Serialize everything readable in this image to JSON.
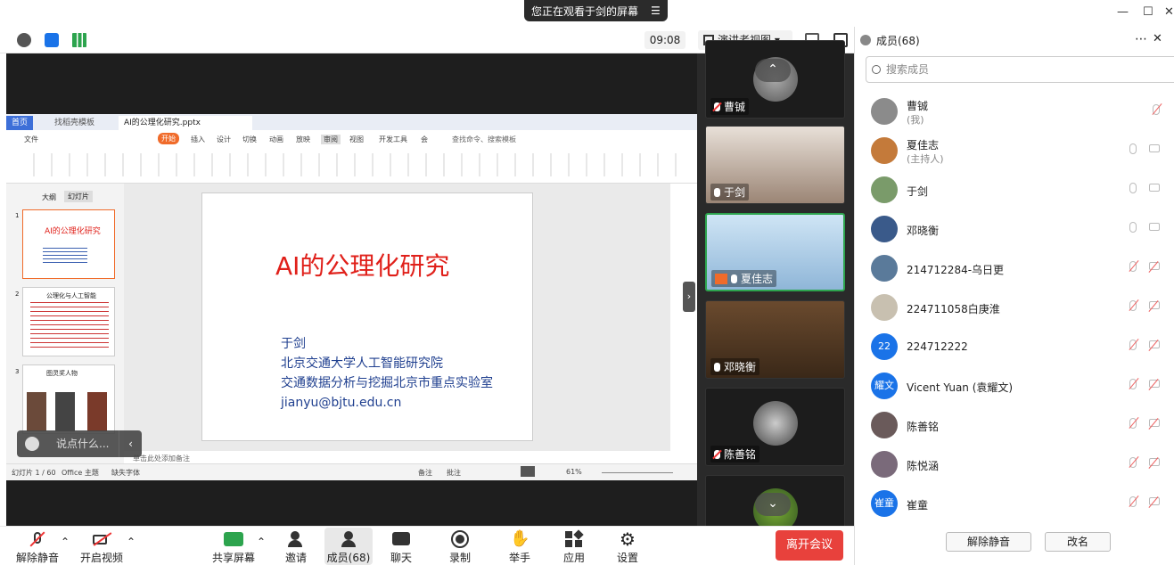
{
  "banner": {
    "text": "您正在观看于剑的屏幕"
  },
  "time": "09:08",
  "view_mode": "演讲者视图",
  "panel": {
    "title": "成员(68)",
    "search_placeholder": "搜索成员",
    "unmute_btn": "解除静音",
    "rename_btn": "改名"
  },
  "members": [
    {
      "name": "曹铖",
      "sub": "(我)",
      "mic_off": true,
      "cam_off": true
    },
    {
      "name": "夏佳志",
      "sub": "(主持人)",
      "mic_off": false,
      "cam_off": false
    },
    {
      "name": "于剑",
      "sub": "",
      "mic_off": false,
      "cam_off": false
    },
    {
      "name": "邓晓衡",
      "sub": "",
      "mic_off": false,
      "cam_off": false
    },
    {
      "name": "214712284-乌日更",
      "sub": "",
      "mic_off": true,
      "cam_off": true
    },
    {
      "name": "224711058白庚淮",
      "sub": "",
      "mic_off": true,
      "cam_off": true
    },
    {
      "name": "224712222",
      "sub": "",
      "avatar_text": "22",
      "avatar_color": "#1a73e8",
      "mic_off": true,
      "cam_off": true
    },
    {
      "name": "Vicent Yuan (袁耀文)",
      "sub": "",
      "avatar_text": "耀文",
      "avatar_color": "#1a73e8",
      "mic_off": true,
      "cam_off": true
    },
    {
      "name": "陈善铭",
      "sub": "",
      "mic_off": true,
      "cam_off": true
    },
    {
      "name": "陈悦涵",
      "sub": "",
      "mic_off": true,
      "cam_off": true
    },
    {
      "name": "崔童",
      "sub": "",
      "avatar_text": "崔童",
      "avatar_color": "#1a73e8",
      "mic_off": true,
      "cam_off": true
    }
  ],
  "tiles": [
    "曹铖",
    "于剑",
    "夏佳志",
    "邓晓衡",
    "陈善铭"
  ],
  "bottom": {
    "mute": "解除静音",
    "video": "开启视频",
    "share": "共享屏幕",
    "invite": "邀请",
    "members": "成员(68)",
    "chat": "聊天",
    "record": "录制",
    "raise": "举手",
    "apps": "应用",
    "settings": "设置",
    "leave": "离开会议"
  },
  "chat_placeholder": "说点什么...",
  "wps": {
    "tab_home": "首页",
    "tab_template": "找稻壳模板",
    "tab_file": "AI的公理化研究.pptx",
    "menu": [
      "文件",
      "开始",
      "插入",
      "设计",
      "切换",
      "动画",
      "放映",
      "审阅",
      "视图",
      "开发工具",
      "会"
    ],
    "search": "查找命令、搜索模板",
    "outline": "大纲",
    "slides": "幻灯片",
    "slide_title": "AI的公理化研究",
    "lines": [
      "于剑",
      "北京交通大学人工智能研究院",
      "交通数据分析与挖掘北京市重点实验室",
      "jianyu@bjtu.edu.cn"
    ],
    "status_page": "幻灯片 1 / 60",
    "status_theme": "Office 主题",
    "status_font": "缺失字体",
    "status_notes": "备注",
    "status_comment": "批注",
    "zoom": "61%",
    "notes_hint": "单击此处添加备注",
    "thumb_nums": [
      "1",
      "2",
      "3"
    ],
    "thumb2_title": "公理化与人工智能",
    "thumb3_title": "图灵奖人物"
  },
  "colors": {
    "title_red": "#e0201a",
    "text_blue": "#1f3f8f",
    "accent": "#e8413c",
    "brand": "#1a73e8"
  }
}
